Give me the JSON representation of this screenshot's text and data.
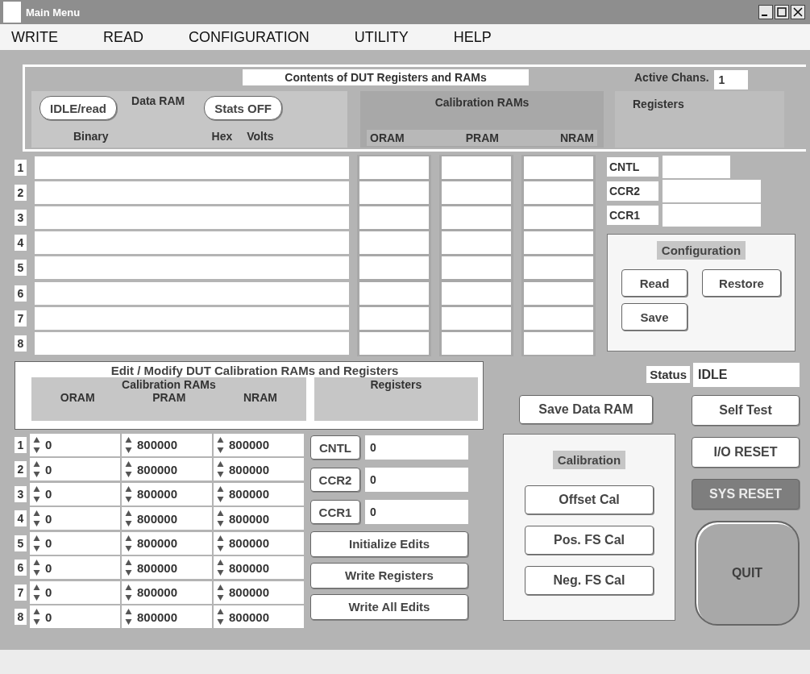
{
  "window": {
    "title": "Main Menu"
  },
  "menu": [
    "WRITE",
    "READ",
    "CONFIGURATION",
    "UTILITY",
    "HELP"
  ],
  "contents_panel": {
    "title": "Contents of DUT Registers and RAMs",
    "active_chans_label": "Active Chans.",
    "active_chans_value": "1",
    "mode_button": "IDLE/read",
    "data_ram_label": "Data RAM",
    "stats_button": "Stats OFF",
    "data_columns": [
      "Binary",
      "Hex",
      "Volts"
    ],
    "calibration_label": "Calibration RAMs",
    "calibration_columns": [
      "ORAM",
      "PRAM",
      "NRAM"
    ],
    "registers_label": "Registers"
  },
  "data_rows": [
    "1",
    "2",
    "3",
    "4",
    "5",
    "6",
    "7",
    "8"
  ],
  "registers": [
    "CNTL",
    "CCR2",
    "CCR1"
  ],
  "configuration": {
    "title": "Configuration",
    "buttons": [
      "Read",
      "Restore",
      "Save"
    ]
  },
  "edit_panel": {
    "title": "Edit / Modify DUT Calibration RAMs and Registers",
    "calibration_label": "Calibration RAMs",
    "columns": [
      "ORAM",
      "PRAM",
      "NRAM"
    ],
    "registers_label": "Registers",
    "rows": [
      {
        "index": "1",
        "oram": "0",
        "pram": "800000",
        "nram": "800000"
      },
      {
        "index": "2",
        "oram": "0",
        "pram": "800000",
        "nram": "800000"
      },
      {
        "index": "3",
        "oram": "0",
        "pram": "800000",
        "nram": "800000"
      },
      {
        "index": "4",
        "oram": "0",
        "pram": "800000",
        "nram": "800000"
      },
      {
        "index": "5",
        "oram": "0",
        "pram": "800000",
        "nram": "800000"
      },
      {
        "index": "6",
        "oram": "0",
        "pram": "800000",
        "nram": "800000"
      },
      {
        "index": "7",
        "oram": "0",
        "pram": "800000",
        "nram": "800000"
      },
      {
        "index": "8",
        "oram": "0",
        "pram": "800000",
        "nram": "800000"
      }
    ],
    "registers": [
      {
        "name": "CNTL",
        "value": "0"
      },
      {
        "name": "CCR2",
        "value": "0"
      },
      {
        "name": "CCR1",
        "value": "0"
      }
    ],
    "buttons": [
      "Initialize Edits",
      "Write Registers",
      "Write All Edits"
    ]
  },
  "status": {
    "label": "Status",
    "value": "IDLE"
  },
  "save_data_ram_button": "Save Data RAM",
  "calibration": {
    "title": "Calibration",
    "buttons": [
      "Offset Cal",
      "Pos. FS Cal",
      "Neg. FS Cal"
    ]
  },
  "system_buttons": [
    {
      "label": "Self Test",
      "disabled": false
    },
    {
      "label": "I/O RESET",
      "disabled": false
    },
    {
      "label": "SYS RESET",
      "disabled": true
    }
  ],
  "quit_button": {
    "label": "QUIT",
    "disabled": true
  }
}
